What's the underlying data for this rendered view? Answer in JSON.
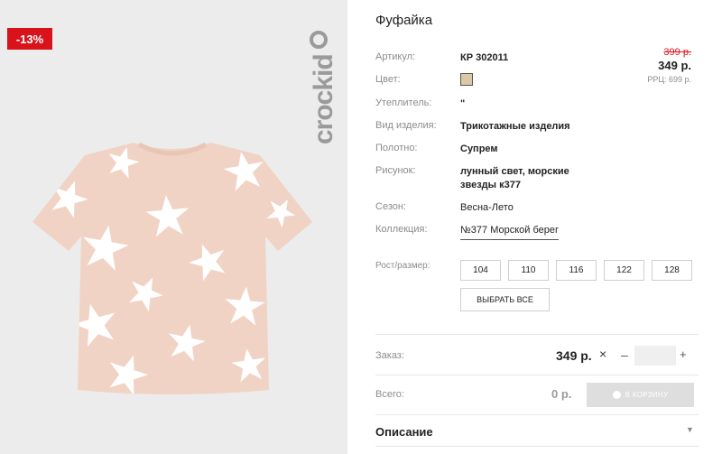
{
  "product": {
    "discount": "-13%",
    "brand_logo": "crockid",
    "title": "Фуфайка",
    "old_price": "399 р.",
    "price": "349 р.",
    "rrp": "РРЦ: 699 р.",
    "swatch_color": "#dcc7a7"
  },
  "attributes": {
    "article": {
      "label": "Артикул:",
      "value": "КР 302011"
    },
    "color": {
      "label": "Цвет:"
    },
    "insulation": {
      "label": "Утеплитель:",
      "value": "\""
    },
    "type": {
      "label": "Вид изделия:",
      "value": "Трикотажные изделия"
    },
    "fabric": {
      "label": "Полотно:",
      "value": "Супрем"
    },
    "print": {
      "label": "Рисунок:",
      "value_line1": "лунный свет, морские",
      "value_line2": "звезды к377"
    },
    "season": {
      "label": "Сезон:",
      "value": "Весна-Лето"
    },
    "collection": {
      "label": "Коллекция:",
      "value": "№377 Морской берег"
    }
  },
  "sizes": {
    "label": "Рост/размер:",
    "options": [
      "104",
      "110",
      "116",
      "122",
      "128"
    ],
    "select_all": "ВЫБРАТЬ ВСЕ"
  },
  "order": {
    "label": "Заказ:",
    "price": "349 р.",
    "times": "×",
    "minus": "–",
    "plus": "+",
    "quantity": ""
  },
  "total": {
    "label": "Всего:",
    "value": "0 р.",
    "cart_button": "В КОРЗИНУ"
  },
  "description": {
    "title": "Описание",
    "chevron": "▼"
  }
}
